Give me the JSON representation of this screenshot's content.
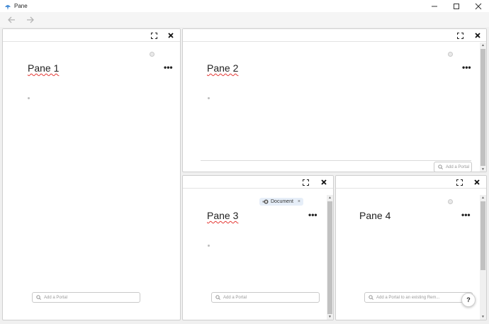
{
  "window": {
    "title": "Pane",
    "minimize": "—",
    "maximize": "☐",
    "close": "✕"
  },
  "nav": {
    "back": "←",
    "forward": "→"
  },
  "panes": [
    {
      "title": "Pane 1",
      "more": "•••",
      "portal_placeholder": "Add a Portal"
    },
    {
      "title": "Pane 2",
      "more": "•••",
      "portal_placeholder": "Add a Portal"
    },
    {
      "title": "Pane 3",
      "more": "•••",
      "portal_placeholder": "Add a Portal",
      "tag": {
        "label": "Document",
        "close": "×"
      }
    },
    {
      "title": "Pane 4",
      "more": "•••",
      "portal_placeholder": "Add a Portal to an existing Rem..."
    }
  ],
  "help": {
    "label": "?"
  },
  "icons": [
    "app-icon",
    "back-arrow-icon",
    "forward-arrow-icon",
    "expand-icon",
    "close-icon",
    "search-icon",
    "document-icon",
    "more-icon",
    "help-icon"
  ],
  "colors": {
    "squiggle": "#e53935",
    "tag_bg": "#e6eef8",
    "scroll_thumb": "#c1c1c1"
  }
}
